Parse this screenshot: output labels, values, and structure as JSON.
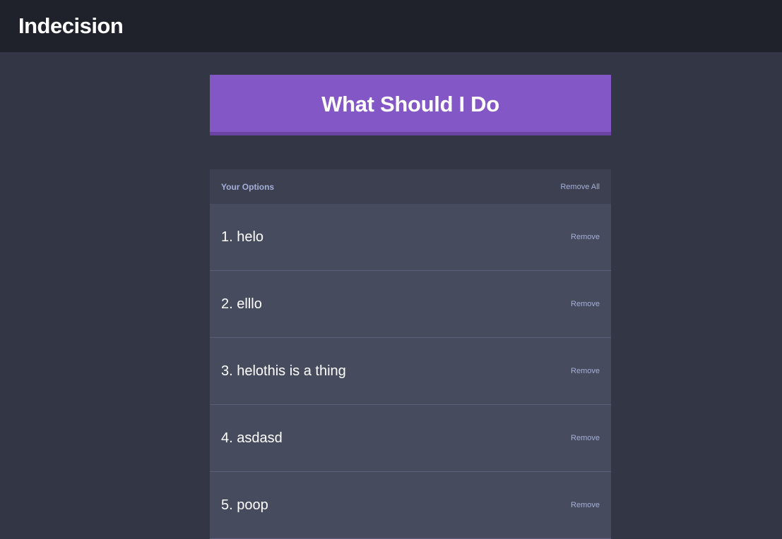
{
  "header": {
    "title": "Indecision"
  },
  "action": {
    "label": "What Should I Do"
  },
  "widget": {
    "title": "Your Options",
    "remove_all_label": "Remove All",
    "options": [
      {
        "text": "1. helo",
        "remove_label": "Remove"
      },
      {
        "text": "2. elllo",
        "remove_label": "Remove"
      },
      {
        "text": "3. helothis is a thing",
        "remove_label": "Remove"
      },
      {
        "text": "4. asdasd",
        "remove_label": "Remove"
      },
      {
        "text": "5. poop",
        "remove_label": "Remove"
      }
    ]
  },
  "colors": {
    "header_bg": "#20222b",
    "page_bg": "#333745",
    "accent": "#8357c5",
    "widget_bg": "#464b5e",
    "widget_header_bg": "#3c4051",
    "muted_text": "#a5afd7"
  }
}
